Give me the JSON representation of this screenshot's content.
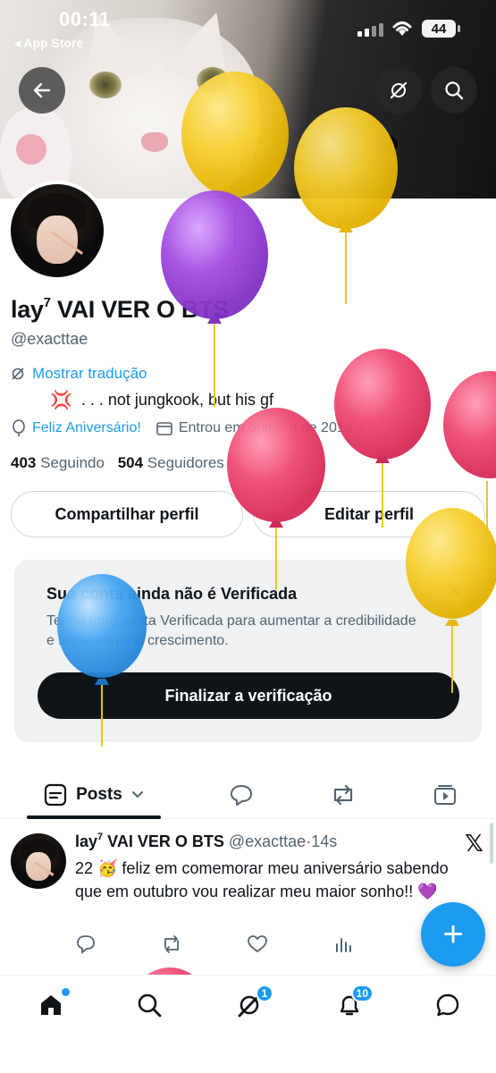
{
  "status_bar": {
    "time": "00:11",
    "back_to_app": "◂ App Store",
    "battery": "44"
  },
  "header": {
    "back_icon": "arrow-left-icon",
    "grok_icon": "slash-circle-icon",
    "search_icon": "search-icon"
  },
  "profile": {
    "name": "lay",
    "name_sup": "7",
    "name_rest": " VAI VER O BTS",
    "handle": "@exacttae",
    "translate_label": "Mostrar tradução",
    "bio_emoji": "💢",
    "bio_text": ". . . not jungkook, but his gf",
    "birthday_label": "Feliz Aniversário!",
    "joined_label": "Entrou em outubro de 2018",
    "following_count": "403",
    "following_label": "Seguindo",
    "followers_count": "504",
    "followers_label": "Seguidores",
    "share_button": "Compartilhar perfil",
    "edit_button": "Editar perfil"
  },
  "verify_card": {
    "title": "Sua conta ainda não é Verificada",
    "text": "Tenha uma conta Verificada para aumentar a credibilidade e impulsionar o crescimento.",
    "button": "Finalizar a verificação",
    "close": "✕"
  },
  "tabs": {
    "posts_label": "Posts"
  },
  "tweet": {
    "name": "lay",
    "name_sup": "7",
    "name_rest": " VAI VER O BTS",
    "handle": "@exacttae",
    "separator": "·",
    "time": "14s",
    "text": "22 🥳 feliz em comemorar meu aniversário sabendo que em outubro vou realizar meu maior sonho!! 💜",
    "x_logo": "𝕏"
  },
  "fab": {
    "label": "+"
  },
  "nav": {
    "grok_badge": "1",
    "notifications_badge": "10"
  },
  "colors": {
    "accent": "#1d9bf0",
    "text": "#0f1419",
    "secondary": "#536471",
    "balloon_yellow": "#f7cf2f",
    "balloon_pink": "#ef4a72",
    "balloon_purple": "#a24ae0",
    "balloon_blue": "#47a6f2"
  }
}
